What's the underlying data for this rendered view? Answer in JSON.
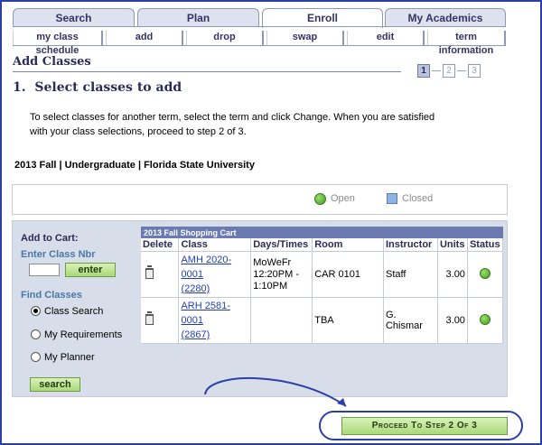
{
  "tabs": {
    "search": "Search",
    "plan": "Plan",
    "enroll": "Enroll",
    "my_academics": "My Academics"
  },
  "subtabs": {
    "my_class_schedule": "my class schedule",
    "add": "add",
    "drop": "drop",
    "swap": "swap",
    "edit": "edit",
    "term_information": "term information"
  },
  "page": {
    "title": "Add Classes",
    "steps": [
      "1",
      "2",
      "3"
    ],
    "step_heading": "1.  Select classes to add",
    "instructions": "To select classes for another term, select the term and click Change.  When you are satisfied with your class selections, proceed to step 2 of 3.",
    "term": "2013 Fall | Undergraduate | Florida State University"
  },
  "legend": {
    "open": "Open",
    "closed": "Closed"
  },
  "left_panel": {
    "add_to_cart": "Add to Cart:",
    "enter_class_nbr": "Enter Class Nbr",
    "class_nbr_value": "",
    "enter_button": "enter",
    "find_classes": "Find Classes",
    "options": [
      "Class Search",
      "My Requirements",
      "My Planner"
    ],
    "selected_option": "Class Search",
    "search_button": "search"
  },
  "cart": {
    "title": "2013 Fall Shopping Cart",
    "headers": [
      "Delete",
      "Class",
      "Days/Times",
      "Room",
      "Instructor",
      "Units",
      "Status"
    ],
    "rows": [
      {
        "class_code": "AMH 2020-0001",
        "class_nbr": "(2280)",
        "days_times": "MoWeFr 12:20PM - 1:10PM",
        "room": "CAR 0101",
        "instructor": "Staff",
        "units": "3.00",
        "status": "open"
      },
      {
        "class_code": "ARH 2581-0001",
        "class_nbr": "(2867)",
        "days_times": "",
        "room": "TBA",
        "instructor": "G. Chismar",
        "units": "3.00",
        "status": "open"
      }
    ]
  },
  "proceed_button": "Proceed To Step 2 Of 3",
  "colors": {
    "annotation_blue": "#2b3fa8",
    "open_green": "#3f9c1e",
    "closed_blue": "#8fb4e3",
    "button_green": "#a9d87a"
  }
}
